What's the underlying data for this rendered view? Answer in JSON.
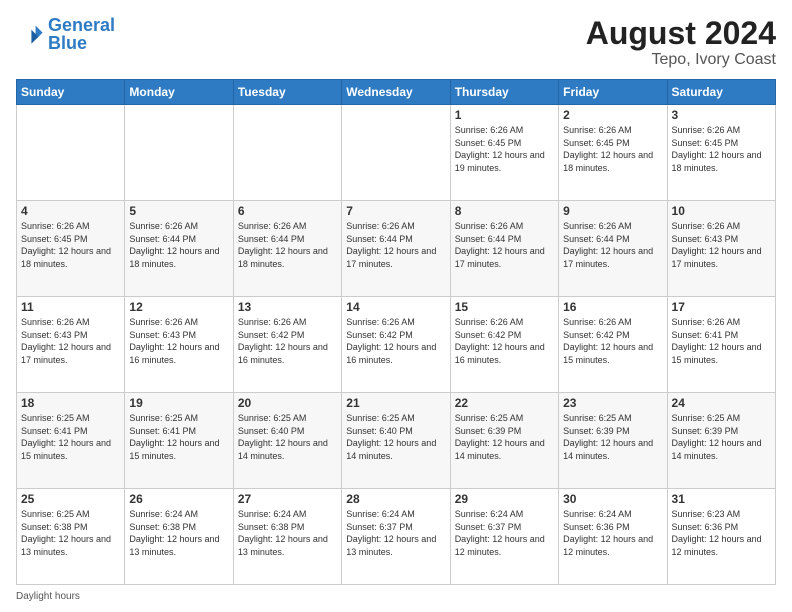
{
  "logo": {
    "line1": "General",
    "line2": "Blue"
  },
  "title": "August 2024",
  "subtitle": "Tepo, Ivory Coast",
  "days_of_week": [
    "Sunday",
    "Monday",
    "Tuesday",
    "Wednesday",
    "Thursday",
    "Friday",
    "Saturday"
  ],
  "footer_label": "Daylight hours",
  "weeks": [
    [
      {
        "day": "",
        "info": ""
      },
      {
        "day": "",
        "info": ""
      },
      {
        "day": "",
        "info": ""
      },
      {
        "day": "",
        "info": ""
      },
      {
        "day": "1",
        "info": "Sunrise: 6:26 AM\nSunset: 6:45 PM\nDaylight: 12 hours and 19 minutes."
      },
      {
        "day": "2",
        "info": "Sunrise: 6:26 AM\nSunset: 6:45 PM\nDaylight: 12 hours and 18 minutes."
      },
      {
        "day": "3",
        "info": "Sunrise: 6:26 AM\nSunset: 6:45 PM\nDaylight: 12 hours and 18 minutes."
      }
    ],
    [
      {
        "day": "4",
        "info": "Sunrise: 6:26 AM\nSunset: 6:45 PM\nDaylight: 12 hours and 18 minutes."
      },
      {
        "day": "5",
        "info": "Sunrise: 6:26 AM\nSunset: 6:44 PM\nDaylight: 12 hours and 18 minutes."
      },
      {
        "day": "6",
        "info": "Sunrise: 6:26 AM\nSunset: 6:44 PM\nDaylight: 12 hours and 18 minutes."
      },
      {
        "day": "7",
        "info": "Sunrise: 6:26 AM\nSunset: 6:44 PM\nDaylight: 12 hours and 17 minutes."
      },
      {
        "day": "8",
        "info": "Sunrise: 6:26 AM\nSunset: 6:44 PM\nDaylight: 12 hours and 17 minutes."
      },
      {
        "day": "9",
        "info": "Sunrise: 6:26 AM\nSunset: 6:44 PM\nDaylight: 12 hours and 17 minutes."
      },
      {
        "day": "10",
        "info": "Sunrise: 6:26 AM\nSunset: 6:43 PM\nDaylight: 12 hours and 17 minutes."
      }
    ],
    [
      {
        "day": "11",
        "info": "Sunrise: 6:26 AM\nSunset: 6:43 PM\nDaylight: 12 hours and 17 minutes."
      },
      {
        "day": "12",
        "info": "Sunrise: 6:26 AM\nSunset: 6:43 PM\nDaylight: 12 hours and 16 minutes."
      },
      {
        "day": "13",
        "info": "Sunrise: 6:26 AM\nSunset: 6:42 PM\nDaylight: 12 hours and 16 minutes."
      },
      {
        "day": "14",
        "info": "Sunrise: 6:26 AM\nSunset: 6:42 PM\nDaylight: 12 hours and 16 minutes."
      },
      {
        "day": "15",
        "info": "Sunrise: 6:26 AM\nSunset: 6:42 PM\nDaylight: 12 hours and 16 minutes."
      },
      {
        "day": "16",
        "info": "Sunrise: 6:26 AM\nSunset: 6:42 PM\nDaylight: 12 hours and 15 minutes."
      },
      {
        "day": "17",
        "info": "Sunrise: 6:26 AM\nSunset: 6:41 PM\nDaylight: 12 hours and 15 minutes."
      }
    ],
    [
      {
        "day": "18",
        "info": "Sunrise: 6:25 AM\nSunset: 6:41 PM\nDaylight: 12 hours and 15 minutes."
      },
      {
        "day": "19",
        "info": "Sunrise: 6:25 AM\nSunset: 6:41 PM\nDaylight: 12 hours and 15 minutes."
      },
      {
        "day": "20",
        "info": "Sunrise: 6:25 AM\nSunset: 6:40 PM\nDaylight: 12 hours and 14 minutes."
      },
      {
        "day": "21",
        "info": "Sunrise: 6:25 AM\nSunset: 6:40 PM\nDaylight: 12 hours and 14 minutes."
      },
      {
        "day": "22",
        "info": "Sunrise: 6:25 AM\nSunset: 6:39 PM\nDaylight: 12 hours and 14 minutes."
      },
      {
        "day": "23",
        "info": "Sunrise: 6:25 AM\nSunset: 6:39 PM\nDaylight: 12 hours and 14 minutes."
      },
      {
        "day": "24",
        "info": "Sunrise: 6:25 AM\nSunset: 6:39 PM\nDaylight: 12 hours and 14 minutes."
      }
    ],
    [
      {
        "day": "25",
        "info": "Sunrise: 6:25 AM\nSunset: 6:38 PM\nDaylight: 12 hours and 13 minutes."
      },
      {
        "day": "26",
        "info": "Sunrise: 6:24 AM\nSunset: 6:38 PM\nDaylight: 12 hours and 13 minutes."
      },
      {
        "day": "27",
        "info": "Sunrise: 6:24 AM\nSunset: 6:38 PM\nDaylight: 12 hours and 13 minutes."
      },
      {
        "day": "28",
        "info": "Sunrise: 6:24 AM\nSunset: 6:37 PM\nDaylight: 12 hours and 13 minutes."
      },
      {
        "day": "29",
        "info": "Sunrise: 6:24 AM\nSunset: 6:37 PM\nDaylight: 12 hours and 12 minutes."
      },
      {
        "day": "30",
        "info": "Sunrise: 6:24 AM\nSunset: 6:36 PM\nDaylight: 12 hours and 12 minutes."
      },
      {
        "day": "31",
        "info": "Sunrise: 6:23 AM\nSunset: 6:36 PM\nDaylight: 12 hours and 12 minutes."
      }
    ]
  ]
}
